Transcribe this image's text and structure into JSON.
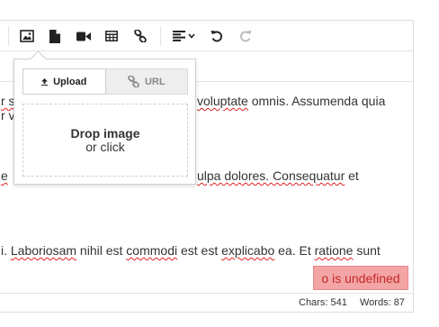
{
  "toolbar": {
    "buttons": [
      {
        "name": "image-icon"
      },
      {
        "name": "file-icon"
      },
      {
        "name": "video-icon"
      },
      {
        "name": "table-icon"
      },
      {
        "name": "link-icon"
      },
      {
        "name": "align-icon"
      },
      {
        "name": "undo-icon"
      },
      {
        "name": "redo-icon"
      }
    ]
  },
  "image_popup": {
    "tabs": {
      "upload": "Upload",
      "url": "URL"
    },
    "dropzone": {
      "title": "Drop image",
      "subtitle": "or click"
    }
  },
  "content": {
    "line1": {
      "pre": "r s",
      "mid": "",
      "text_a": "voluptate",
      "text_b": " omnis. Assumenda quia"
    },
    "line1b": {
      "text": "r v"
    },
    "line2": {
      "pre": "e",
      "text_a": "ulpa dolores. ",
      "text_b": "Consequatur",
      "text_c": " et"
    },
    "line3": {
      "t1": "i. ",
      "t2": "Laboriosam",
      "t3": " nihil est ",
      "t4": "commodi",
      "t5": " est est ",
      "t6": "explicabo",
      "t7": " ea. Et ",
      "t8": "ratione",
      "t9": " sunt"
    }
  },
  "error": {
    "message": "o is undefined"
  },
  "status": {
    "chars": "Chars: 541",
    "words": "Words: 87"
  },
  "colors": {
    "error_bg": "#f3a5a5",
    "error_text": "#c62828",
    "spellcheck": "#dd2222"
  }
}
